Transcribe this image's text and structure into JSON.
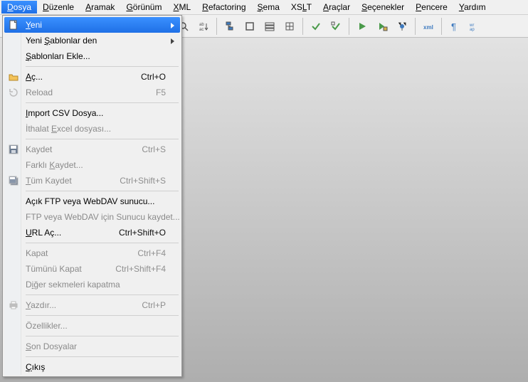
{
  "menubar": {
    "items": [
      {
        "label": "Dosya",
        "u": 0,
        "active": true
      },
      {
        "label": "Düzenle",
        "u": 0
      },
      {
        "label": "Aramak",
        "u": 0
      },
      {
        "label": "Görünüm",
        "u": 0
      },
      {
        "label": "XML",
        "u": 0
      },
      {
        "label": "Refactoring",
        "u": 0
      },
      {
        "label": "Şema",
        "u": 0
      },
      {
        "label": "XSLT",
        "u": 2
      },
      {
        "label": "Araçlar",
        "u": 0
      },
      {
        "label": "Seçenekler",
        "u": 0
      },
      {
        "label": "Pencere",
        "u": 0
      },
      {
        "label": "Yardım",
        "u": 0
      }
    ]
  },
  "dropdown": {
    "groups": [
      [
        {
          "label": "Yeni",
          "u": 0,
          "icon": "new-file-icon",
          "submenu": true,
          "highlight": true
        },
        {
          "label": "Yeni Şablonlar den",
          "u": 5,
          "submenu": true
        },
        {
          "label": "Şablonları Ekle...",
          "u": 0
        }
      ],
      [
        {
          "label": "Aç...",
          "u": 0,
          "icon": "open-folder-icon",
          "shortcut": "Ctrl+O"
        },
        {
          "label": "Reload",
          "u": -1,
          "icon": "reload-icon",
          "shortcut": "F5",
          "disabled": true
        }
      ],
      [
        {
          "label": "Import CSV Dosya...",
          "u": 0
        },
        {
          "label": "İthalat Excel dosyası...",
          "u": 8,
          "disabled": true
        }
      ],
      [
        {
          "label": "Kaydet",
          "u": -1,
          "icon": "save-icon",
          "shortcut": "Ctrl+S",
          "disabled": true
        },
        {
          "label": "Farklı Kaydet...",
          "u": 7,
          "disabled": true
        },
        {
          "label": "Tüm Kaydet",
          "u": 0,
          "icon": "save-all-icon",
          "shortcut": "Ctrl+Shift+S",
          "disabled": true
        }
      ],
      [
        {
          "label": "Açık FTP veya WebDAV sunucu...",
          "u": -1
        },
        {
          "label": "FTP veya WebDAV için Sunucu kaydet...",
          "u": -1,
          "disabled": true
        },
        {
          "label": "URL Aç...",
          "u": 0,
          "shortcut": "Ctrl+Shift+O"
        }
      ],
      [
        {
          "label": "Kapat",
          "u": -1,
          "shortcut": "Ctrl+F4",
          "disabled": true
        },
        {
          "label": "Tümünü Kapat",
          "u": -1,
          "shortcut": "Ctrl+Shift+F4",
          "disabled": true
        },
        {
          "label": "Diğer sekmeleri kapatma",
          "u": 1,
          "disabled": true
        }
      ],
      [
        {
          "label": "Yazdır...",
          "u": 0,
          "icon": "print-icon",
          "shortcut": "Ctrl+P",
          "disabled": true
        }
      ],
      [
        {
          "label": "Özellikler...",
          "u": -1,
          "disabled": true
        }
      ],
      [
        {
          "label": "Son Dosyalar",
          "u": 0,
          "disabled": true
        }
      ],
      [
        {
          "label": "Çıkış",
          "u": 0
        }
      ]
    ]
  },
  "toolbar": {
    "groups": [
      [
        "new-button",
        "open-button",
        "save-button",
        "save-all-button",
        "cut-button",
        "copy-button"
      ],
      [
        "outdent-button",
        "indent-button"
      ],
      [
        "find-button",
        "replace-button"
      ],
      [
        "tree-button",
        "box-button",
        "stack-button",
        "grid-button"
      ],
      [
        "validate-button",
        "validate-schema-button"
      ],
      [
        "run-button",
        "run-config-button",
        "debug-button"
      ],
      [
        "xml-view-button"
      ],
      [
        "pilcrow-button",
        "wrap-button"
      ]
    ]
  }
}
